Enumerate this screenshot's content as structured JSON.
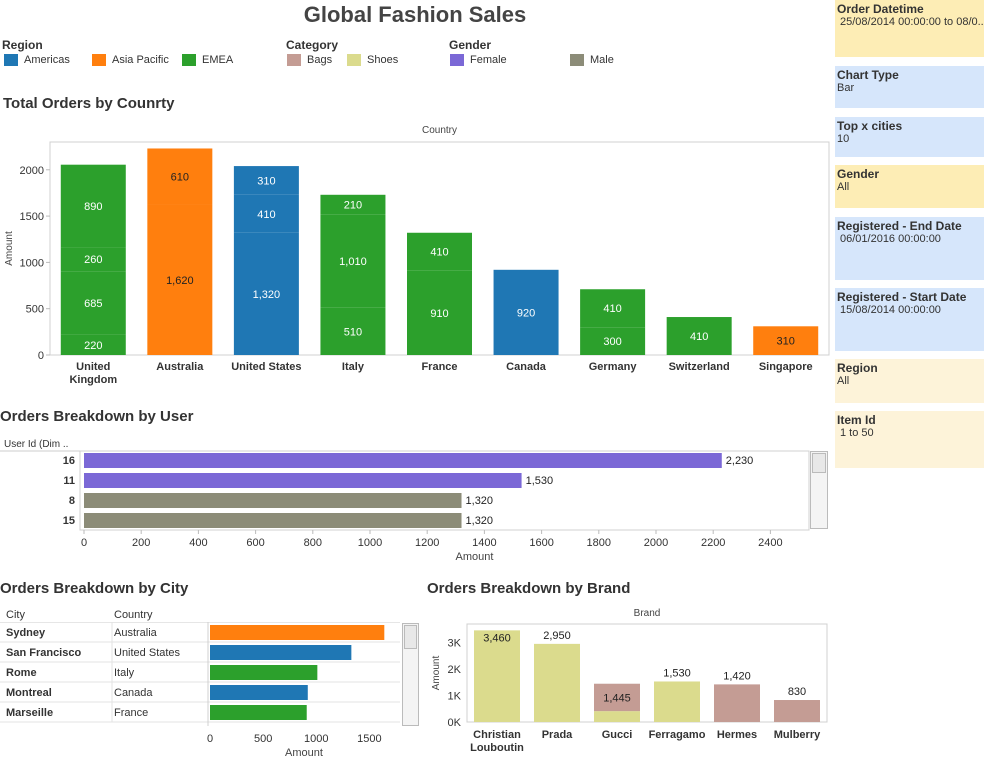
{
  "title": "Global Fashion Sales",
  "legend": {
    "region": {
      "heading": "Region",
      "items": [
        {
          "label": "Americas",
          "color": "#1f77b4"
        },
        {
          "label": "Asia Pacific",
          "color": "#ff7f0e"
        },
        {
          "label": "EMEA",
          "color": "#2ca02c"
        }
      ]
    },
    "category": {
      "heading": "Category",
      "items": [
        {
          "label": "Bags",
          "color": "#c49c94"
        },
        {
          "label": "Shoes",
          "color": "#dbdb8d"
        }
      ]
    },
    "gender": {
      "heading": "Gender",
      "items": [
        {
          "label": "Female",
          "color": "#7b68d6"
        },
        {
          "label": "Male",
          "color": "#8c8c78"
        }
      ]
    }
  },
  "filters": [
    {
      "label": "Order Datetime",
      "value": "25/08/2014 00:00:00 to 08/0..",
      "color": "#fdedb5"
    },
    {
      "label": "Chart Type",
      "value": "Bar",
      "color": "#d6e6fb"
    },
    {
      "label": "Top x cities",
      "value": "10",
      "color": "#d6e6fb"
    },
    {
      "label": "Gender",
      "value": "All",
      "color": "#fdedb5"
    },
    {
      "label": "Registered - End Date",
      "value": "06/01/2016 00:00:00",
      "color": "#d6e6fb"
    },
    {
      "label": "Registered - Start Date",
      "value": "15/08/2014 00:00:00",
      "color": "#d6e6fb"
    },
    {
      "label": "Region",
      "value": "All",
      "color": "#fdf3d9"
    },
    {
      "label": "Item Id",
      "value": "1 to 50",
      "color": "#fdf3d9"
    }
  ],
  "chart_data": [
    {
      "id": "country",
      "type": "bar",
      "stacked": true,
      "title": "Total Orders by Counrty",
      "header": "Country",
      "xlabel": "",
      "ylabel": "Amount",
      "ylim": [
        0,
        2300
      ],
      "yticks": [
        0,
        500,
        1000,
        1500,
        2000
      ],
      "grid": false,
      "categories": [
        {
          "label": [
            "United",
            "Kingdom"
          ],
          "region": "EMEA",
          "color": "#2ca02c",
          "segments": [
            220,
            685,
            260,
            890
          ]
        },
        {
          "label": [
            "Australia"
          ],
          "region": "Asia Pacific",
          "color": "#ff7f0e",
          "segments": [
            1620,
            610
          ]
        },
        {
          "label": [
            "United States"
          ],
          "region": "Americas",
          "color": "#1f77b4",
          "segments": [
            1320,
            410,
            310
          ]
        },
        {
          "label": [
            "Italy"
          ],
          "region": "EMEA",
          "color": "#2ca02c",
          "segments": [
            510,
            1010,
            210
          ]
        },
        {
          "label": [
            "France"
          ],
          "region": "EMEA",
          "color": "#2ca02c",
          "segments": [
            910,
            410
          ]
        },
        {
          "label": [
            "Canada"
          ],
          "region": "Americas",
          "color": "#1f77b4",
          "segments": [
            920
          ]
        },
        {
          "label": [
            "Germany"
          ],
          "region": "EMEA",
          "color": "#2ca02c",
          "segments": [
            300,
            410
          ]
        },
        {
          "label": [
            "Switzerland"
          ],
          "region": "EMEA",
          "color": "#2ca02c",
          "segments": [
            410
          ]
        },
        {
          "label": [
            "Singapore"
          ],
          "region": "Asia Pacific",
          "color": "#ff7f0e",
          "segments": [
            310
          ]
        }
      ],
      "segment_labels": [
        [
          "220",
          "685",
          "260",
          "890"
        ],
        [
          "1,620",
          "610"
        ],
        [
          "1,320",
          "410",
          "310"
        ],
        [
          "510",
          "1,010",
          "210"
        ],
        [
          "910",
          "410"
        ],
        [
          "920"
        ],
        [
          "300",
          "410"
        ],
        [
          "410"
        ],
        [
          "310"
        ]
      ]
    },
    {
      "id": "user",
      "type": "bar",
      "orientation": "horizontal",
      "title": "Orders Breakdown by User",
      "row_header": "User Id (Dim ..",
      "xlabel": "Amount",
      "xlim": [
        0,
        2500
      ],
      "xticks": [
        0,
        200,
        400,
        600,
        800,
        1000,
        1200,
        1400,
        1600,
        1800,
        2000,
        2200,
        2400
      ],
      "rows": [
        {
          "label": "16",
          "value": 2230,
          "value_label": "2,230",
          "color": "#7b68d6"
        },
        {
          "label": "11",
          "value": 1530,
          "value_label": "1,530",
          "color": "#7b68d6"
        },
        {
          "label": "8",
          "value": 1320,
          "value_label": "1,320",
          "color": "#8c8c78"
        },
        {
          "label": "15",
          "value": 1320,
          "value_label": "1,320",
          "color": "#8c8c78"
        }
      ]
    },
    {
      "id": "city",
      "type": "bar",
      "orientation": "horizontal",
      "title": "Orders Breakdown by City",
      "columns": [
        "City",
        "Country"
      ],
      "xlabel": "Amount",
      "xlim": [
        0,
        1750
      ],
      "xticks": [
        0,
        500,
        1000,
        1500
      ],
      "rows": [
        {
          "city": "Sydney",
          "country": "Australia",
          "value": 1640,
          "color": "#ff7f0e"
        },
        {
          "city": "San Francisco",
          "country": "United States",
          "value": 1330,
          "color": "#1f77b4"
        },
        {
          "city": "Rome",
          "country": "Italy",
          "value": 1010,
          "color": "#2ca02c"
        },
        {
          "city": "Montreal",
          "country": "Canada",
          "value": 920,
          "color": "#1f77b4"
        },
        {
          "city": "Marseille",
          "country": "France",
          "value": 910,
          "color": "#2ca02c"
        }
      ]
    },
    {
      "id": "brand",
      "type": "bar",
      "stacked": true,
      "title": "Orders Breakdown by Brand",
      "header": "Brand",
      "ylabel": "Amount",
      "ylim": [
        0,
        3700
      ],
      "yticks": [
        {
          "v": 0,
          "label": "0K"
        },
        {
          "v": 1000,
          "label": "1K"
        },
        {
          "v": 2000,
          "label": "2K"
        },
        {
          "v": 3000,
          "label": "3K"
        }
      ],
      "categories": [
        {
          "label": [
            "Christian",
            "Louboutin"
          ],
          "segments": [
            {
              "v": 3460,
              "color": "#dbdb8d"
            }
          ],
          "total_label": "3,460"
        },
        {
          "label": [
            "Prada"
          ],
          "segments": [
            {
              "v": 2950,
              "color": "#dbdb8d"
            }
          ],
          "total_label": "2,950"
        },
        {
          "label": [
            "Gucci"
          ],
          "segments": [
            {
              "v": 410,
              "color": "#dbdb8d"
            },
            {
              "v": 1445,
              "color": "#c49c94"
            }
          ],
          "total_label": "1,445"
        },
        {
          "label": [
            "Ferragamo"
          ],
          "segments": [
            {
              "v": 1530,
              "color": "#dbdb8d"
            }
          ],
          "total_label": "1,530"
        },
        {
          "label": [
            "Hermes"
          ],
          "segments": [
            {
              "v": 1420,
              "color": "#c49c94"
            }
          ],
          "total_label": "1,420"
        },
        {
          "label": [
            "Mulberry"
          ],
          "segments": [
            {
              "v": 830,
              "color": "#c49c94"
            }
          ],
          "total_label": "830"
        }
      ]
    }
  ]
}
